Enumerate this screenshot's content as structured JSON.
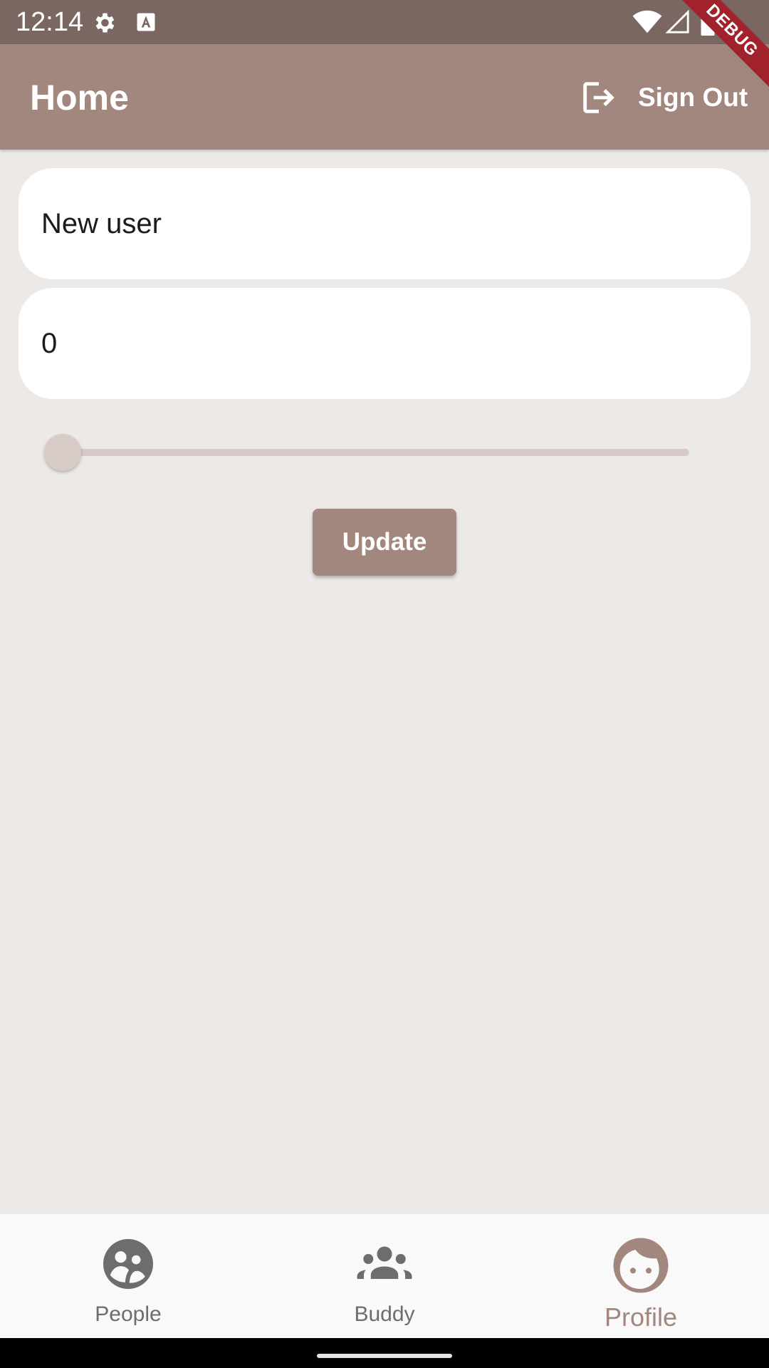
{
  "status_bar": {
    "time": "12:14",
    "icons": [
      "gear-icon",
      "font-a-icon",
      "wifi-icon",
      "signal-icon",
      "battery-icon"
    ]
  },
  "debug_banner": "DEBUG",
  "app_bar": {
    "title": "Home",
    "sign_out_label": "Sign Out",
    "sign_out_icon": "logout-icon"
  },
  "form": {
    "name_value": "New user",
    "number_value": "0",
    "slider_value": 0,
    "update_label": "Update"
  },
  "bottom_nav": {
    "items": [
      {
        "label": "People",
        "icon": "people-icon",
        "active": false
      },
      {
        "label": "Buddy",
        "icon": "group-icon",
        "active": false
      },
      {
        "label": "Profile",
        "icon": "face-icon",
        "active": true
      }
    ]
  },
  "colors": {
    "status_bar": "#7a6761",
    "app_bar": "#a1877d",
    "background": "#ede9e7",
    "active_tab": "#a1877d",
    "inactive_tab": "#6d6d6d",
    "debug_banner": "#a1222a"
  }
}
